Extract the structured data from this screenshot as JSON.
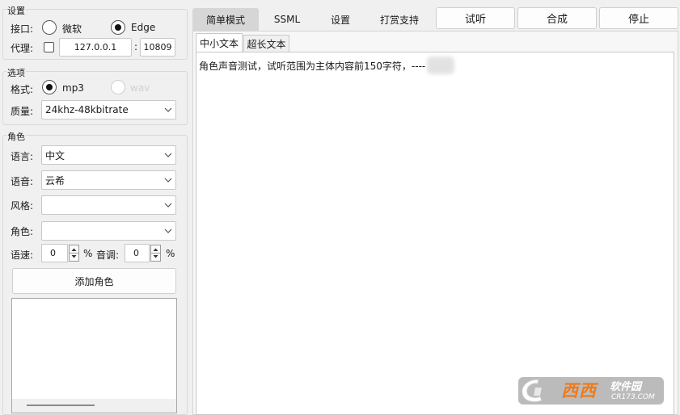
{
  "settings": {
    "group_title": "设置",
    "interface_label": "接口:",
    "interface_options": [
      "微软",
      "Edge"
    ],
    "interface_selected": "Edge",
    "proxy_label": "代理:",
    "proxy_host": "127.0.0.1",
    "proxy_sep": ":",
    "proxy_port": "10809"
  },
  "options": {
    "group_title": "选项",
    "format_label": "格式:",
    "format_options": [
      "mp3",
      "wav"
    ],
    "format_selected": "mp3",
    "quality_label": "质量:",
    "quality_value": "24khz-48kbitrate"
  },
  "role": {
    "group_title": "角色",
    "language_label": "语言:",
    "language_value": "中文",
    "voice_label": "语音:",
    "voice_value": "云希",
    "style_label": "风格:",
    "style_value": "",
    "role_label": "角色:",
    "role_value": "",
    "speed_label": "语速:",
    "speed_value": "0",
    "percent1": "%",
    "pitch_label": "音调:",
    "pitch_value": "0",
    "percent2": "%",
    "add_role_button": "添加角色"
  },
  "tabs": [
    "简单模式",
    "SSML",
    "设置",
    "打赏支持"
  ],
  "active_tab": "简单模式",
  "actions": {
    "preview": "试听",
    "synthesize": "合成",
    "stop": "停止"
  },
  "subtabs": [
    "中小文本",
    "超长文本"
  ],
  "active_subtab": "中小文本",
  "editor_text": "角色声音测试，试听范围为主体内容前150字符，----",
  "watermark": {
    "main": "西西",
    "side": "软件园",
    "url": "CR173.COM"
  }
}
